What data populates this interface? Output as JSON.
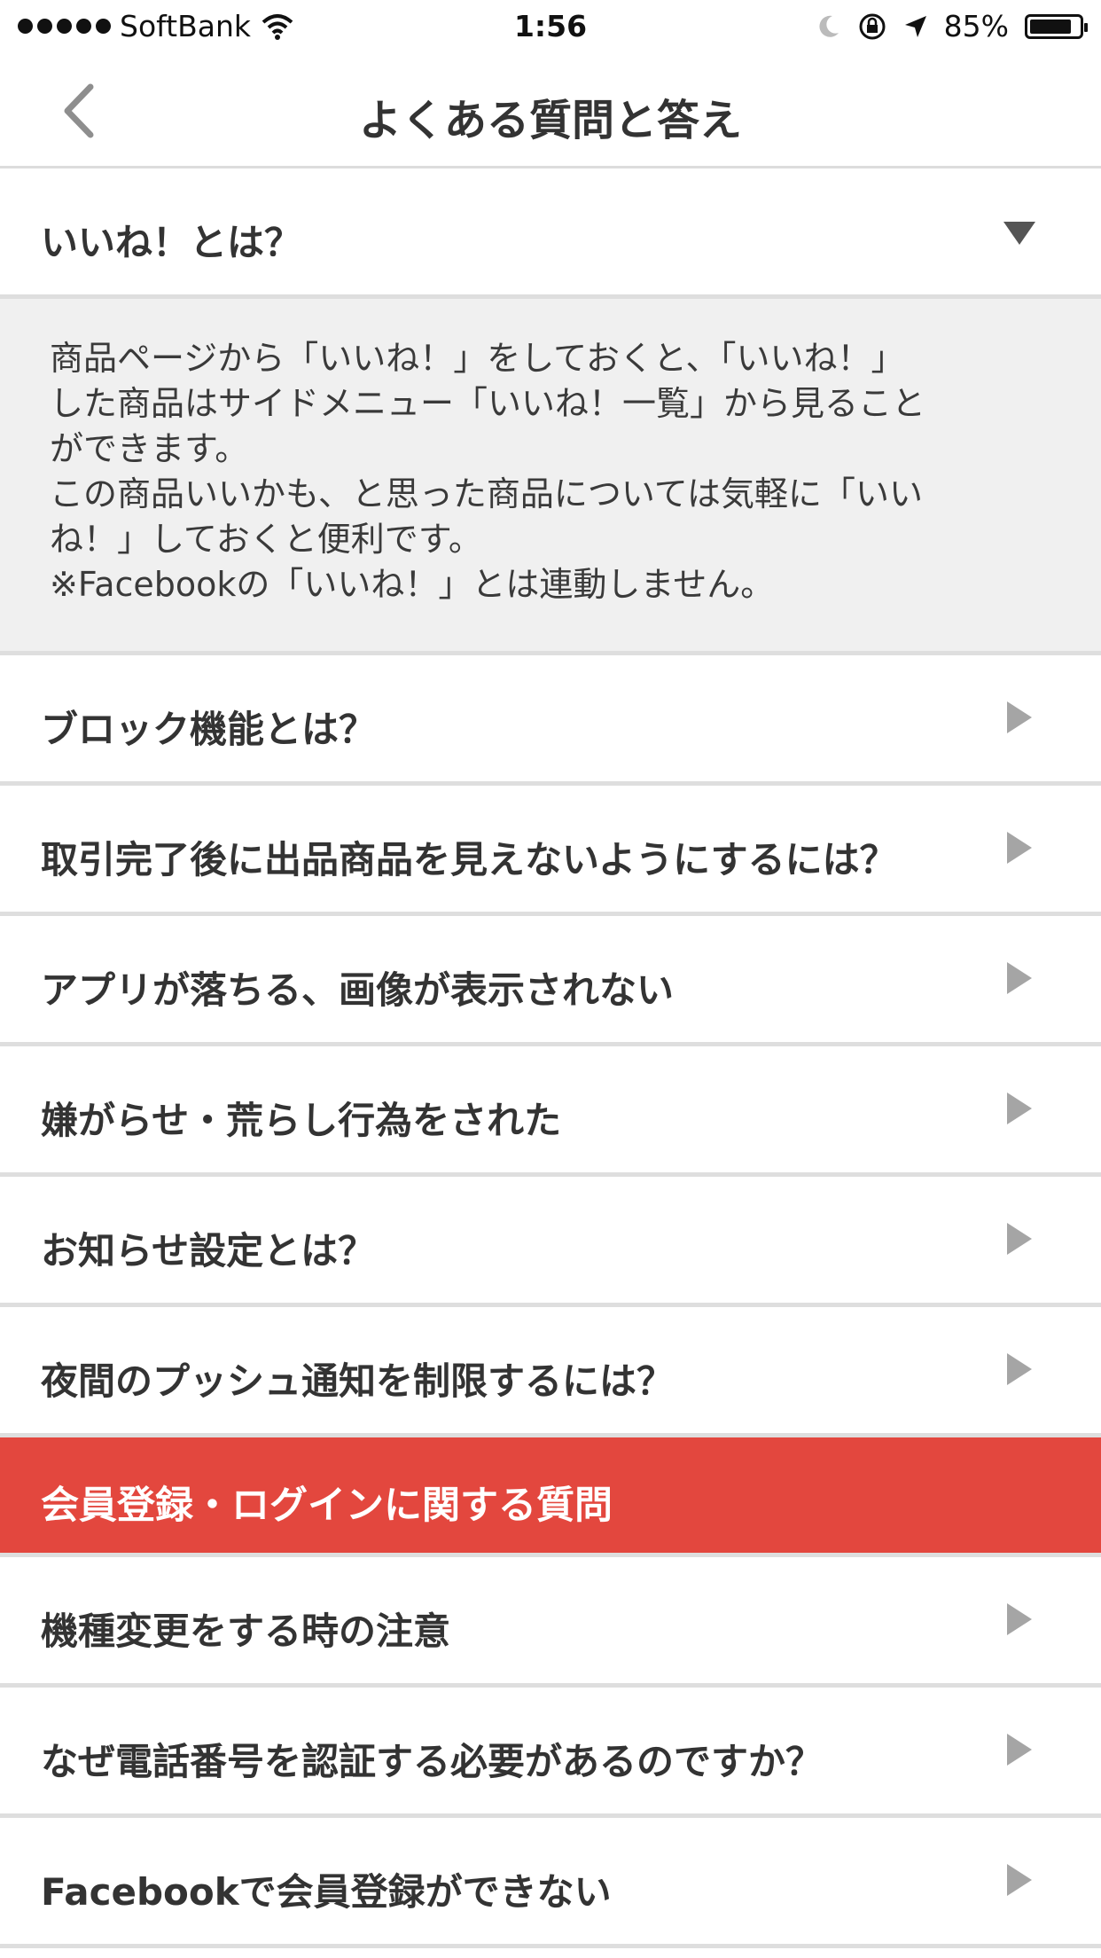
{
  "status_bar": {
    "carrier": "SoftBank",
    "time": "1:56",
    "battery_percent": "85%",
    "battery_level": 0.85,
    "icons": [
      "signal-dots-icon",
      "wifi-icon",
      "moon-icon",
      "rotation-lock-icon",
      "location-arrow-icon",
      "battery-icon"
    ]
  },
  "header": {
    "title": "よくある質問と答え",
    "back_icon": "chevron-left-icon"
  },
  "expanded_item": {
    "question": "いいね！とは？",
    "answer_lines": [
      "商品ページから「いいね！」をしておくと、「いいね！」",
      "した商品はサイドメニュー「いいね！一覧」から見ること",
      "ができます。",
      "この商品いいかも、と思った商品については気軽に「いい",
      "ね！」しておくと便利です。",
      "※Facebookの「いいね！」とは連動しません。"
    ]
  },
  "items_group1": [
    "ブロック機能とは？",
    "取引完了後に出品商品を見えないようにするには？",
    "アプリが落ちる、画像が表示されない",
    "嫌がらせ・荒らし行為をされた",
    "お知らせ設定とは？",
    "夜間のプッシュ通知を制限するには？"
  ],
  "section": {
    "title": "会員登録・ログインに関する質問",
    "color": "#e3473e"
  },
  "items_group2": [
    "機種変更をする時の注意",
    "なぜ電話番号を認証する必要があるのですか？",
    "Facebookで会員登録ができない"
  ]
}
